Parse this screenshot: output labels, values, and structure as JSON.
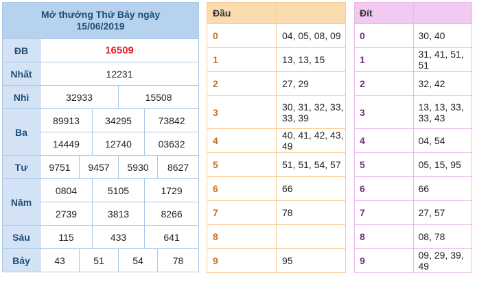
{
  "results": {
    "header_line1": "Mở thưởng Thứ Bảy ngày",
    "header_line2": "15/06/2019",
    "rows": [
      {
        "label": "ĐB",
        "values": [
          "16509"
        ]
      },
      {
        "label": "Nhất",
        "values": [
          "12231"
        ]
      },
      {
        "label": "Nhì",
        "values": [
          "32933",
          "15508"
        ]
      },
      {
        "label": "Ba",
        "values": [
          "89913",
          "34295",
          "73842",
          "14449",
          "12740",
          "03632"
        ]
      },
      {
        "label": "Tư",
        "values": [
          "9751",
          "9457",
          "5930",
          "8627"
        ]
      },
      {
        "label": "Năm",
        "values": [
          "0804",
          "5105",
          "1729",
          "2739",
          "3813",
          "8266"
        ]
      },
      {
        "label": "Sáu",
        "values": [
          "115",
          "433",
          "641"
        ]
      },
      {
        "label": "Bảy",
        "values": [
          "43",
          "51",
          "54",
          "78"
        ]
      }
    ]
  },
  "dau": {
    "title": "Đầu",
    "rows": [
      {
        "key": "0",
        "value": "04, 05, 08, 09"
      },
      {
        "key": "1",
        "value": "13, 13, 15"
      },
      {
        "key": "2",
        "value": "27, 29"
      },
      {
        "key": "3",
        "value": "30, 31, 32, 33, 33, 39"
      },
      {
        "key": "4",
        "value": "40, 41, 42, 43, 49"
      },
      {
        "key": "5",
        "value": "51, 51, 54, 57"
      },
      {
        "key": "6",
        "value": "66"
      },
      {
        "key": "7",
        "value": "78"
      },
      {
        "key": "8",
        "value": ""
      },
      {
        "key": "9",
        "value": "95"
      }
    ]
  },
  "dit": {
    "title": "Đít",
    "rows": [
      {
        "key": "0",
        "value": "30, 40"
      },
      {
        "key": "1",
        "value": "31, 41, 51, 51"
      },
      {
        "key": "2",
        "value": "32, 42"
      },
      {
        "key": "3",
        "value": "13, 13, 33, 33, 43"
      },
      {
        "key": "4",
        "value": "04, 54"
      },
      {
        "key": "5",
        "value": "05, 15, 95"
      },
      {
        "key": "6",
        "value": "66"
      },
      {
        "key": "7",
        "value": "27, 57"
      },
      {
        "key": "8",
        "value": "08, 78"
      },
      {
        "key": "9",
        "value": "09, 29, 39, 49"
      }
    ]
  },
  "colors": {
    "special_prize": "#e8202a",
    "results_accent": "#b7d2ee",
    "dau_accent": "#fbdcb0",
    "dit_accent": "#f2c9f0"
  }
}
